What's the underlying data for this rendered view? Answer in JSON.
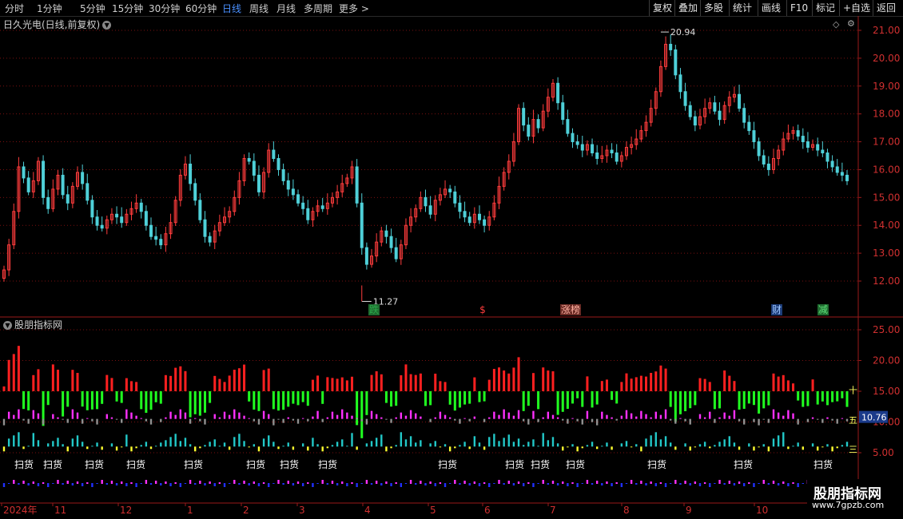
{
  "toolbar": {
    "periods": [
      "分时",
      "1分钟",
      "5分钟",
      "15分钟",
      "30分钟",
      "60分钟",
      "日线",
      "周线",
      "月线",
      "多周期",
      "更多 >"
    ],
    "active_period": "日线",
    "right_buttons": [
      "复权",
      "叠加",
      "多股",
      "统计",
      "画线",
      "F10",
      "标记",
      "+自选",
      "返回"
    ]
  },
  "main_panel": {
    "title": "日久光电(日线,前复权)",
    "dropdown_icon": "chevron-down-icon",
    "diamond_icon": "diamond-icon",
    "settings_icon": "gear-icon",
    "high_label": "20.94",
    "low_label": "11.27",
    "event_tags": [
      {
        "text": "跌",
        "color": "#2aa84a",
        "bg": "#1f6a2f"
      },
      {
        "text": "$",
        "color": "#ff3c3c",
        "bg": ""
      },
      {
        "text": "涨榜",
        "color": "#ffb0a0",
        "bg": "#6a2a24"
      },
      {
        "text": "财",
        "color": "#9fc8ff",
        "bg": "#1c3c78"
      },
      {
        "text": "减",
        "color": "#5fe07a",
        "bg": "#1f6a2f"
      }
    ]
  },
  "sub_panel": {
    "title": "股朋指标网",
    "value_badge": "10.76",
    "level_labels": [
      "十",
      "五",
      "三"
    ],
    "signal_text": "扫货"
  },
  "watermark": {
    "title": "股朋指标网",
    "url": "www.7gpzb.com"
  },
  "colors": {
    "up": "#ff3c3c",
    "down": "#4fd0d8",
    "grid": "#7a1010",
    "axis": "#9a1a1a"
  },
  "chart_data": [
    {
      "type": "candlestick",
      "title": "日久光电(日线,前复权)",
      "ylim": [
        11.27,
        20.94
      ],
      "y_ticks": [
        12.0,
        13.0,
        14.0,
        15.0,
        16.0,
        17.0,
        18.0,
        19.0,
        20.0,
        21.0
      ],
      "x_ticks": [
        "2024年",
        "11",
        "12",
        "1",
        "2",
        "3",
        "4",
        "5",
        "6",
        "7",
        "8",
        "9",
        "10"
      ],
      "close": [
        12.4,
        13.3,
        14.5,
        16.1,
        15.7,
        15.2,
        15.6,
        16.3,
        15.0,
        14.6,
        15.3,
        15.8,
        15.1,
        14.8,
        15.4,
        15.9,
        15.5,
        14.9,
        14.3,
        14.0,
        13.9,
        14.2,
        14.4,
        14.3,
        14.1,
        14.4,
        14.6,
        14.8,
        14.5,
        14.0,
        13.6,
        13.5,
        13.3,
        13.7,
        14.1,
        14.9,
        15.8,
        16.2,
        15.5,
        14.9,
        14.2,
        13.6,
        13.4,
        13.8,
        14.1,
        14.3,
        14.5,
        15.0,
        15.6,
        16.4,
        16.3,
        15.8,
        15.2,
        15.9,
        16.7,
        16.4,
        16.0,
        15.6,
        15.3,
        15.1,
        14.8,
        14.6,
        14.2,
        14.5,
        14.7,
        14.6,
        14.8,
        15.0,
        15.2,
        15.5,
        15.7,
        16.1,
        14.8,
        13.2,
        12.6,
        12.9,
        13.4,
        13.8,
        13.6,
        13.2,
        12.8,
        13.3,
        14.0,
        14.3,
        14.6,
        15.0,
        14.7,
        14.4,
        14.9,
        15.1,
        15.3,
        15.2,
        14.8,
        14.5,
        14.3,
        14.1,
        14.4,
        14.2,
        14.0,
        14.3,
        14.8,
        15.4,
        15.9,
        16.3,
        17.0,
        18.2,
        17.6,
        17.2,
        17.8,
        17.5,
        18.1,
        18.6,
        19.1,
        18.4,
        17.8,
        17.3,
        17.0,
        16.9,
        16.7,
        16.9,
        16.6,
        16.4,
        16.5,
        16.7,
        16.6,
        16.3,
        16.5,
        16.8,
        16.9,
        17.1,
        17.4,
        17.7,
        18.2,
        18.8,
        19.7,
        20.5,
        20.3,
        19.4,
        18.8,
        18.3,
        17.9,
        17.6,
        17.9,
        18.2,
        18.4,
        18.1,
        17.8,
        18.3,
        18.6,
        18.7,
        18.2,
        17.7,
        17.4,
        17.0,
        16.5,
        16.2,
        16.0,
        16.4,
        16.7,
        17.1,
        17.3,
        17.4,
        17.2,
        17.0,
        16.8,
        16.9,
        16.7,
        16.6,
        16.3,
        16.1,
        15.9,
        15.8,
        15.6
      ],
      "high": 20.94,
      "low": 11.27
    },
    {
      "type": "bar",
      "title": "股朋指标网",
      "ylim": [
        0,
        25
      ],
      "y_ticks": [
        5.0,
        10.0,
        15.0,
        20.0,
        25.0
      ],
      "current_value": 10.76
    }
  ]
}
